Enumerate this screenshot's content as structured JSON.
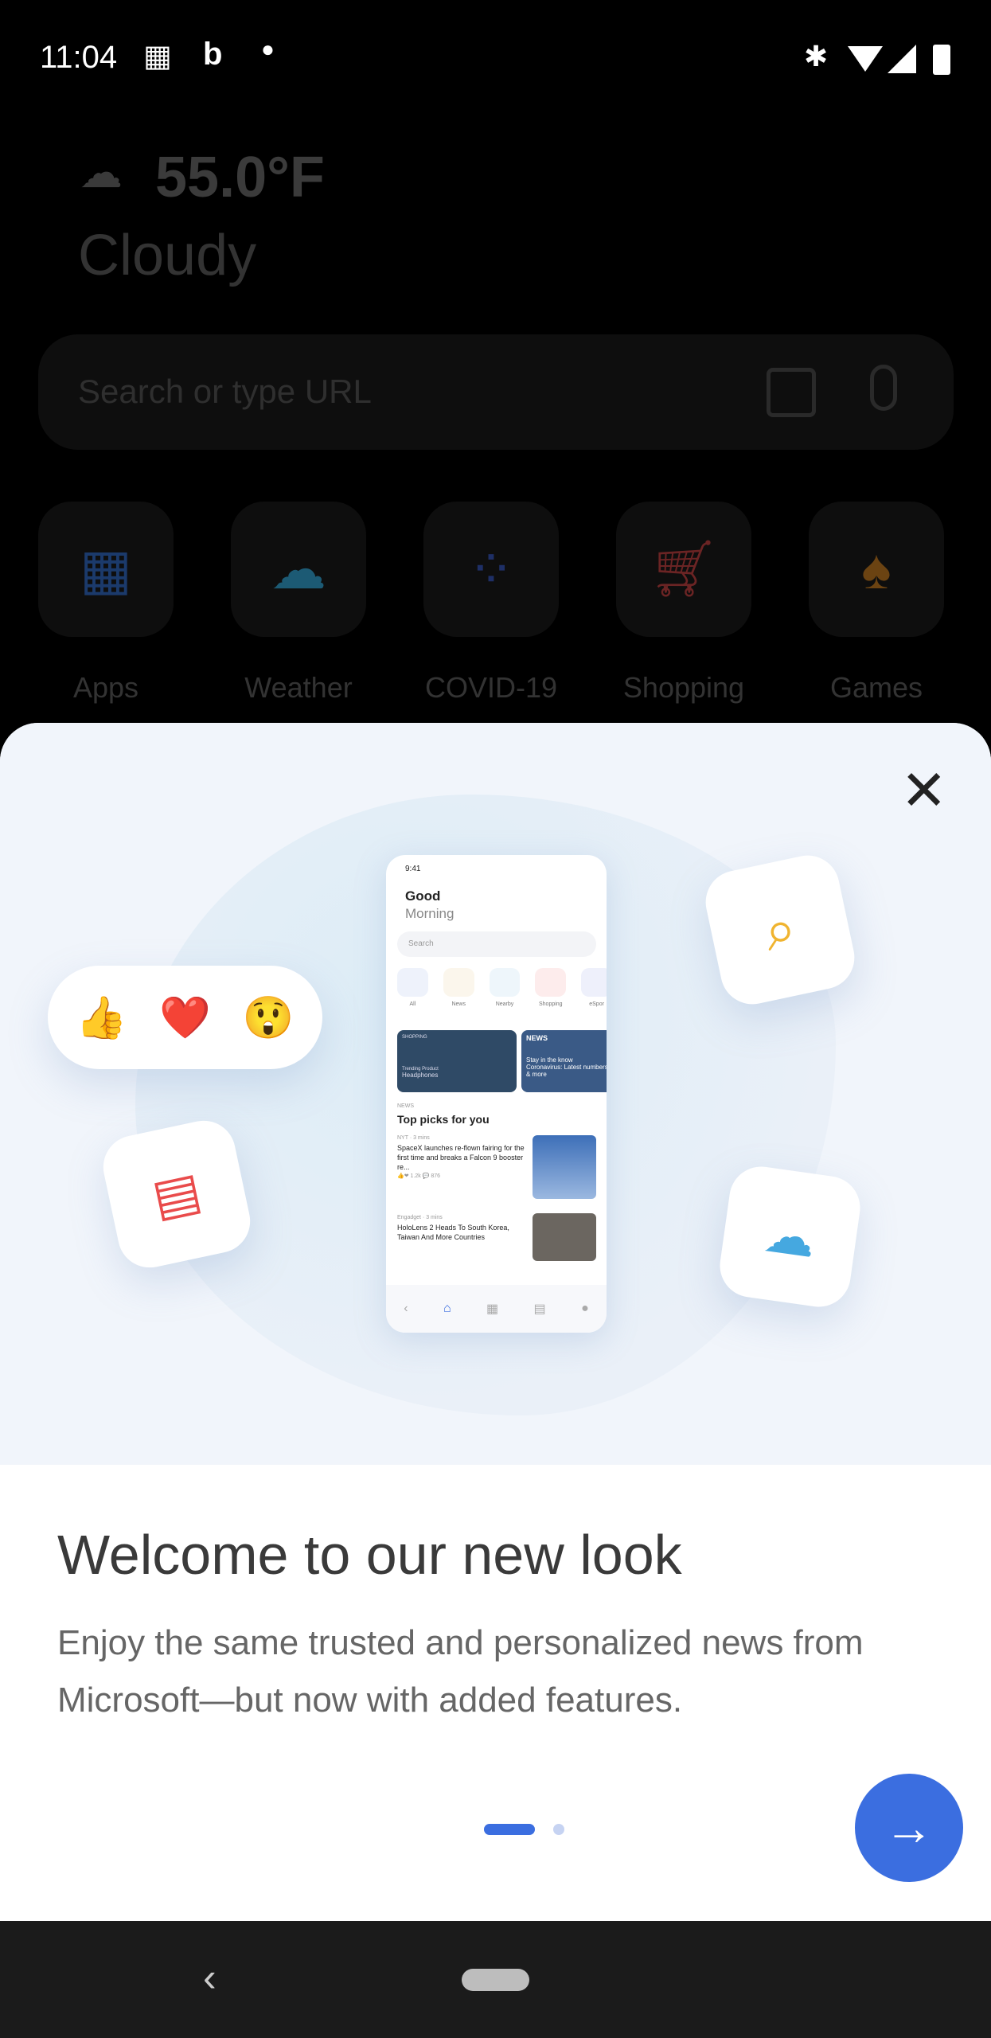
{
  "status_bar": {
    "time": "11:04",
    "icons": [
      "qr-code-icon",
      "bing-icon",
      "dot-icon",
      "bluetooth-icon",
      "wifi-icon",
      "signal-icon",
      "battery-icon"
    ]
  },
  "weather": {
    "icon": "cloud-icon",
    "temperature": "55.0°F",
    "condition": "Cloudy"
  },
  "search": {
    "placeholder": "Search or type URL",
    "icons": [
      "visual-search-icon",
      "microphone-icon"
    ]
  },
  "tiles": [
    {
      "label": "Apps",
      "color": "#1b3a6b"
    },
    {
      "label": "Weather",
      "color": "#1c5a74"
    },
    {
      "label": "COVID-19",
      "color": "#1e2f66"
    },
    {
      "label": "Shopping",
      "color": "#6b2424"
    },
    {
      "label": "Games",
      "color": "#6b4312"
    }
  ],
  "onboarding": {
    "title": "Welcome to our new look",
    "body": "Enjoy the same trusted and personalized news from Microsoft—but now with added features.",
    "page_index": 1,
    "page_count": 2,
    "accent": "#3b6ee0",
    "reactions": [
      "👍",
      "❤️",
      "😲"
    ],
    "mockup": {
      "time": "9:41",
      "greeting1": "Good",
      "greeting2": "Morning",
      "search": "Search",
      "categories": [
        "All",
        "News",
        "Nearby",
        "Shopping",
        "eSpor"
      ],
      "cards": [
        {
          "tag": "SHOPPING",
          "sub": "Trending Product",
          "title": "Headphones"
        },
        {
          "tag": "NEWS",
          "sub": "Stay in the know",
          "title": "Coronavirus: Latest numbers & more"
        }
      ],
      "section": "NEWS",
      "heading": "Top picks for you",
      "articles": [
        {
          "source": "NYT · 3 mins",
          "title": "SpaceX launches re-flown fairing for the first time and breaks a Falcon 9 booster re...",
          "likes": "1.2k",
          "comments": "876"
        },
        {
          "source": "Engadget · 3 mins",
          "title": "HoloLens 2 Heads To South Korea, Taiwan And More Countries"
        }
      ]
    }
  }
}
